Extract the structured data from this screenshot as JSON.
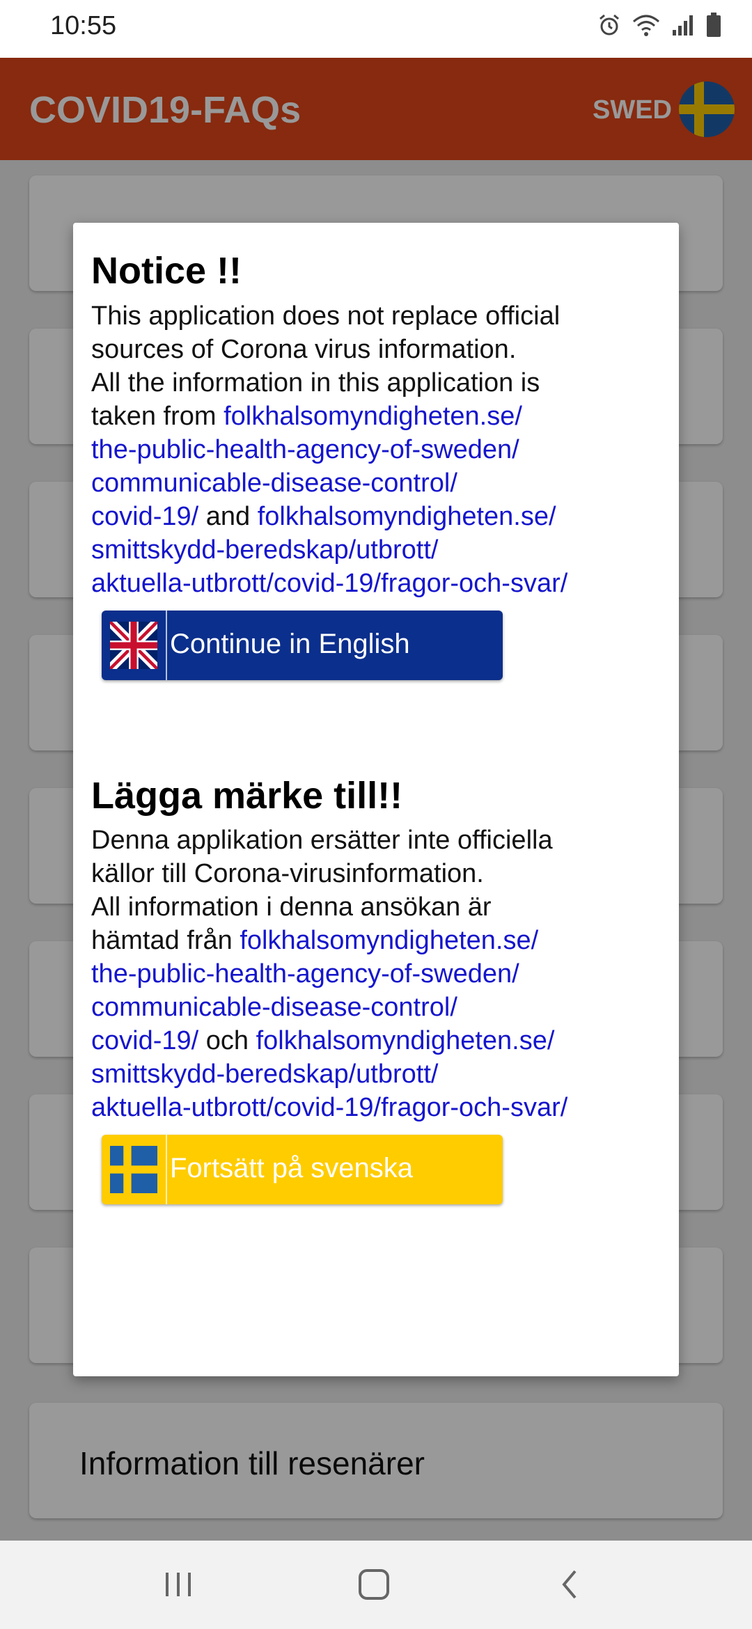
{
  "status_bar": {
    "time": "10:55",
    "icons": [
      "alarm-icon",
      "wifi-icon",
      "signal-icon",
      "battery-icon"
    ]
  },
  "app_bar": {
    "title": "COVID19-FAQs",
    "language_label": "SWED",
    "flag_icon": "sweden-flag-icon",
    "background_color": "#e2461a"
  },
  "background_list": {
    "visible_item_label": "Information till resenärer"
  },
  "dialog": {
    "english": {
      "title": "Notice !!",
      "line1": "This application does not replace official",
      "line2": "sources of Corona virus information.",
      "line3": "All the information in this application is",
      "line4_prefix": "taken from ",
      "link1_part1": "folkhalsomyndigheten.se/",
      "link1_part2": "the-public-health-agency-of-sweden/",
      "link1_part3": "communicable-disease-control/",
      "link1_part4": "covid-19/",
      "conjunction": " and ",
      "link2_part1": "folkhalsomyndigheten.se/",
      "link2_part2": "smittskydd-beredskap/utbrott/",
      "link2_part3": "aktuella-utbrott/covid-19/fragor-och-svar/",
      "button_label": "Continue in English",
      "button_color": "#0b2f8c",
      "button_icon": "uk-flag-icon"
    },
    "swedish": {
      "title": "Lägga märke till!!",
      "line1": "Denna applikation ersätter inte officiella",
      "line2": "källor till Corona-virusinformation.",
      "line3": "All information i denna ansökan är",
      "line4_prefix": "hämtad från ",
      "link1_part1": "folkhalsomyndigheten.se/",
      "link1_part2": "the-public-health-agency-of-sweden/",
      "link1_part3": "communicable-disease-control/",
      "link1_part4": "covid-19/",
      "conjunction": " och ",
      "link2_part1": "folkhalsomyndigheten.se/",
      "link2_part2": "smittskydd-beredskap/utbrott/",
      "link2_part3": "aktuella-utbrott/covid-19/fragor-och-svar/",
      "button_label": "Fortsätt på svenska",
      "button_color": "#ffcc00",
      "button_icon": "sweden-flag-icon"
    },
    "link_color": "#1515cc"
  },
  "nav_bar": {
    "buttons": [
      "recents-icon",
      "home-icon",
      "back-icon"
    ]
  }
}
